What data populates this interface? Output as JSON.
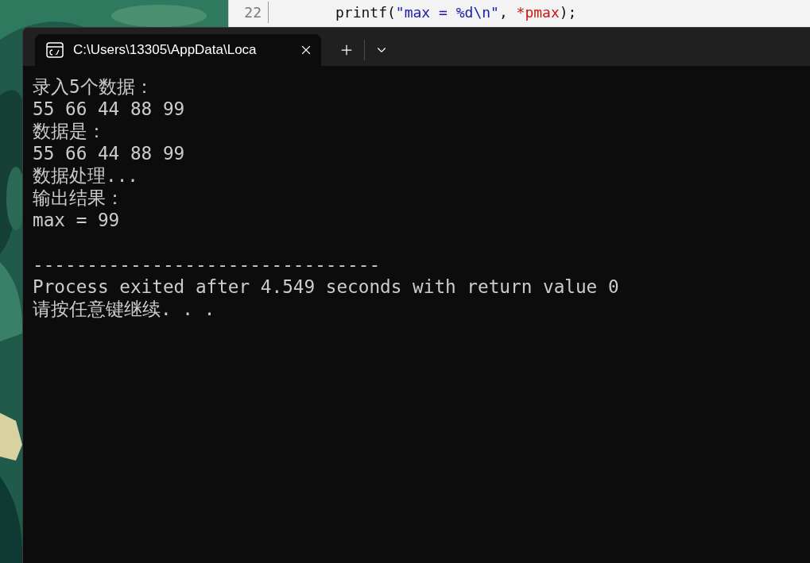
{
  "editor": {
    "line_number": "22",
    "code": [
      {
        "kind": "plain",
        "text": "printf("
      },
      {
        "kind": "string",
        "text": "\"max = %d\\n\""
      },
      {
        "kind": "plain",
        "text": ", "
      },
      {
        "kind": "pointer",
        "text": "*pmax"
      },
      {
        "kind": "plain",
        "text": ");"
      }
    ]
  },
  "terminal": {
    "tabs": [
      {
        "title": "C:\\Users\\13305\\AppData\\Loca",
        "selected": true
      }
    ],
    "lines": [
      "录入5个数据：",
      "55 66 44 88 99",
      "数据是：",
      "55 66 44 88 99",
      "数据处理...",
      "输出结果：",
      "max = 99"
    ],
    "summary": [
      "--------------------------------",
      "Process exited after 4.549 seconds with return value 0",
      "请按任意键继续. . ."
    ]
  }
}
